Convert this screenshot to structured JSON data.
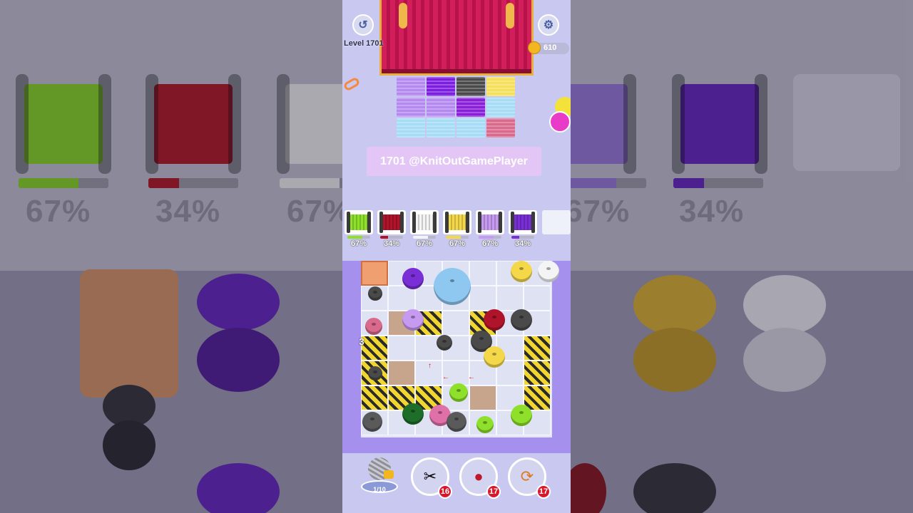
{
  "backdrop": {
    "left_spools": [
      {
        "color": "#7bc51f",
        "percent": "67%",
        "fill": 0.67
      },
      {
        "color": "#a3121f",
        "percent": "34%",
        "fill": 0.34
      },
      {
        "color": "#dddddd",
        "percent": "67%",
        "fill": 0.67
      }
    ],
    "right_spools": [
      {
        "color": "#8a6ec8",
        "percent": "67%",
        "fill": 0.67
      },
      {
        "color": "#5a1fae",
        "percent": "34%",
        "fill": 0.34
      }
    ]
  },
  "hud": {
    "level_label": "Level 1701",
    "coins": "610",
    "undo_icon": "undo-icon",
    "settings_icon": "gear-icon"
  },
  "banner": {
    "text": "1701 @KnitOutGamePlayer"
  },
  "quilt": {
    "colors": [
      "#b48af0",
      "#7c1de0",
      "#4a4a4a",
      "#f4e05a",
      "#b48af0",
      "#b48af0",
      "#8a1fd8",
      "#a6dcf5",
      "#a6dcf5",
      "#a6dcf5",
      "#a6dcf5",
      "#d96a8c"
    ]
  },
  "spools": [
    {
      "color": "#8ee02a",
      "percent": "67%",
      "fill": 0.67
    },
    {
      "color": "#b0142a",
      "percent": "34%",
      "fill": 0.34
    },
    {
      "color": "#f4f4f4",
      "percent": "67%",
      "fill": 0.67
    },
    {
      "color": "#f4d84a",
      "percent": "67%",
      "fill": 0.67
    },
    {
      "color": "#c79af2",
      "percent": "67%",
      "fill": 0.67
    },
    {
      "color": "#7a2ed6",
      "percent": "34%",
      "fill": 0.34
    }
  ],
  "board": {
    "stack_count": "3"
  },
  "tools": {
    "yarn_progress": "1/10",
    "scissors_count": "16",
    "spool_count": "17",
    "magnet_count": "17"
  }
}
